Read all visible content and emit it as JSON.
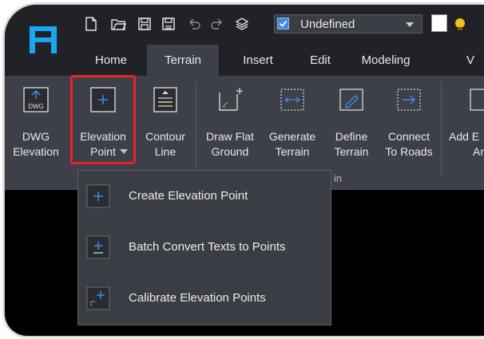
{
  "quick_access": {
    "checkbox_checked": true,
    "style_combo_value": "Undefined",
    "icons": [
      "new-file-icon",
      "open-folder-icon",
      "save-icon",
      "save-as-icon",
      "undo-icon",
      "redo-icon",
      "layers-icon"
    ]
  },
  "tabs": [
    {
      "label": "Home",
      "active": false
    },
    {
      "label": "Terrain",
      "active": true
    },
    {
      "label": "Insert",
      "active": false
    },
    {
      "label": "Edit",
      "active": false
    },
    {
      "label": "Modeling",
      "active": false
    },
    {
      "label": "V",
      "active": false
    }
  ],
  "ribbon": {
    "buttons": [
      {
        "line1": "DWG",
        "line2": "Elevation"
      },
      {
        "line1": "Elevation",
        "line2": "Point"
      },
      {
        "line1": "Contour",
        "line2": "Line"
      },
      {
        "line1": "Draw Flat",
        "line2": "Ground"
      },
      {
        "line1": "Generate",
        "line2": "Terrain"
      },
      {
        "line1": "Define",
        "line2": "Terrain"
      },
      {
        "line1": "Connect",
        "line2": "To Roads"
      },
      {
        "line1": "Add E",
        "line2": "Ar"
      }
    ],
    "panel_title_fragment": "in"
  },
  "dropdown_menu": {
    "items": [
      {
        "label": "Create Elevation Point",
        "icon": "plus-icon"
      },
      {
        "label": "Batch Convert Texts to Points",
        "icon": "batch-convert-icon"
      },
      {
        "label": "Calibrate Elevation Points",
        "icon": "calibrate-icon"
      }
    ]
  },
  "colors": {
    "accent": "#3f8be0",
    "highlight_border": "#e62322",
    "ribbon_bg": "#3d4048",
    "titlebar_bg": "#202228"
  }
}
